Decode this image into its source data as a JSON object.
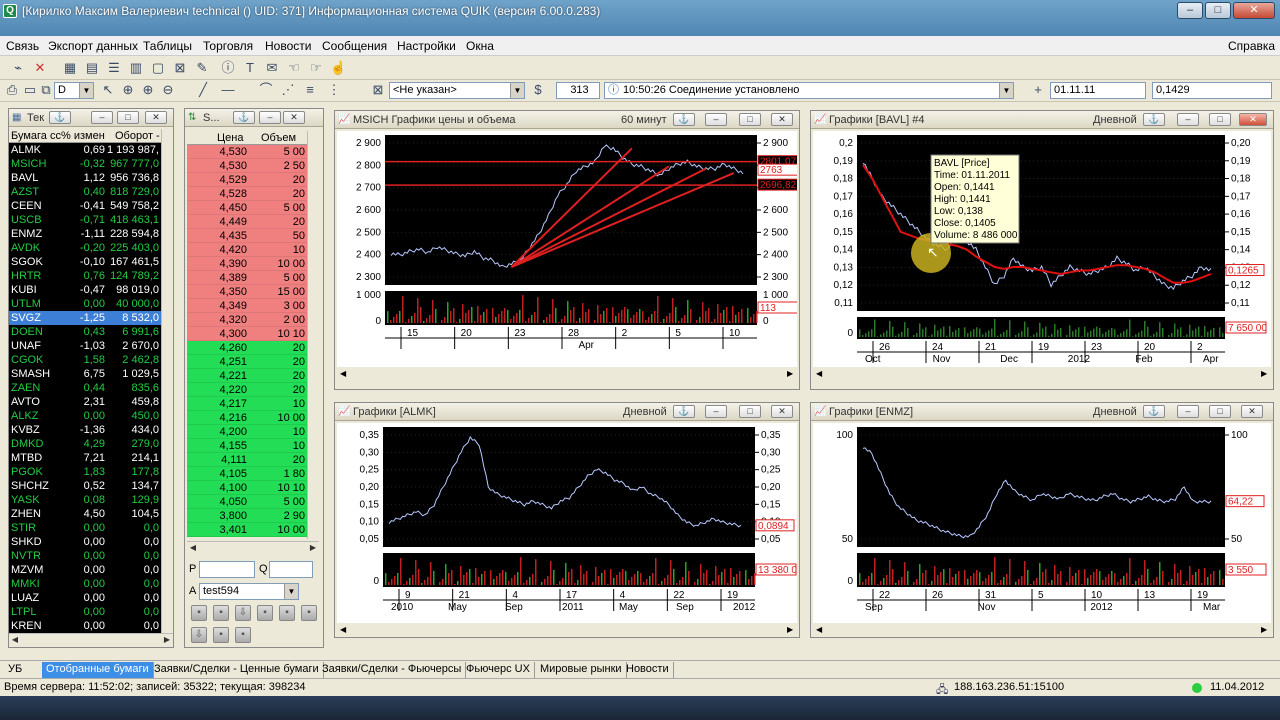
{
  "window": {
    "title": "[Кирилко Максим Валериевич technical ()  UID: 371] Информационная система QUIK (версия 6.00.0.283)",
    "icon": "Q",
    "controls": [
      "–",
      "□",
      "✕"
    ],
    "child_controls": [
      "–",
      "□",
      "✕"
    ]
  },
  "menu": {
    "items": [
      "Связь",
      "Экспорт данных",
      "Таблицы",
      "Торговля",
      "Новости",
      "Сообщения",
      "Настройки",
      "Окна"
    ],
    "help": "Справка"
  },
  "toolbar2": {
    "account_value": "D",
    "client_value": "<Не указан>",
    "count": "313",
    "message": "10:50:26 Соединение установлено",
    "date_value": "01.11.11",
    "price_value": "0,1429"
  },
  "securities": {
    "title": "Тек",
    "headers": [
      "Бумага сс",
      "% измен",
      "Оборот -"
    ],
    "rows": [
      {
        "code": "ALMK",
        "chg": "0,69",
        "turn": "1 193 987,0",
        "color": "#ffffff"
      },
      {
        "code": "MSICH",
        "chg": "-0,32",
        "turn": "967 777,0",
        "color": "#22cc44"
      },
      {
        "code": "BAVL",
        "chg": "1,12",
        "turn": "956 736,8",
        "color": "#ffffff"
      },
      {
        "code": "AZST",
        "chg": "0,40",
        "turn": "818 729,0",
        "color": "#22cc44"
      },
      {
        "code": "CEEN",
        "chg": "-0,41",
        "turn": "549 758,2",
        "color": "#ffffff"
      },
      {
        "code": "USCB",
        "chg": "-0,71",
        "turn": "418 463,1",
        "color": "#22cc44"
      },
      {
        "code": "ENMZ",
        "chg": "-1,11",
        "turn": "228 594,8",
        "color": "#ffffff"
      },
      {
        "code": "AVDK",
        "chg": "-0,20",
        "turn": "225 403,0",
        "color": "#22cc44"
      },
      {
        "code": "SGOK",
        "chg": "-0,10",
        "turn": "167 461,5",
        "color": "#ffffff"
      },
      {
        "code": "HRTR",
        "chg": "0,76",
        "turn": "124 789,2",
        "color": "#22cc44"
      },
      {
        "code": "KUBI",
        "chg": "-0,47",
        "turn": "98 019,0",
        "color": "#ffffff"
      },
      {
        "code": "UTLM",
        "chg": "0,00",
        "turn": "40 000,0",
        "color": "#22cc44"
      },
      {
        "code": "SVGZ",
        "chg": "-1,25",
        "turn": "8 532,0",
        "color": "#ffffff"
      },
      {
        "code": "DOEN",
        "chg": "0,43",
        "turn": "6 991,6",
        "color": "#22cc44"
      },
      {
        "code": "UNAF",
        "chg": "-1,03",
        "turn": "2 670,0",
        "color": "#ffffff"
      },
      {
        "code": "CGOK",
        "chg": "1,58",
        "turn": "2 462,8",
        "color": "#22cc44"
      },
      {
        "code": "SMASH",
        "chg": "6,75",
        "turn": "1 029,5",
        "color": "#ffffff"
      },
      {
        "code": "ZAEN",
        "chg": "0,44",
        "turn": "835,6",
        "color": "#22cc44"
      },
      {
        "code": "AVTO",
        "chg": "2,31",
        "turn": "459,8",
        "color": "#ffffff"
      },
      {
        "code": "ALKZ",
        "chg": "0,00",
        "turn": "450,0",
        "color": "#22cc44"
      },
      {
        "code": "KVBZ",
        "chg": "-1,36",
        "turn": "434,0",
        "color": "#ffffff"
      },
      {
        "code": "DMKD",
        "chg": "4,29",
        "turn": "279,0",
        "color": "#22cc44"
      },
      {
        "code": "MTBD",
        "chg": "7,21",
        "turn": "214,1",
        "color": "#ffffff"
      },
      {
        "code": "PGOK",
        "chg": "1,83",
        "turn": "177,8",
        "color": "#22cc44"
      },
      {
        "code": "SHCHZ",
        "chg": "0,52",
        "turn": "134,7",
        "color": "#ffffff"
      },
      {
        "code": "YASK",
        "chg": "0,08",
        "turn": "129,9",
        "color": "#22cc44"
      },
      {
        "code": "ZHEN",
        "chg": "4,50",
        "turn": "104,5",
        "color": "#ffffff"
      },
      {
        "code": "STIR",
        "chg": "0,00",
        "turn": "0,0",
        "color": "#22cc44"
      },
      {
        "code": "SHKD",
        "chg": "0,00",
        "turn": "0,0",
        "color": "#ffffff"
      },
      {
        "code": "NVTR",
        "chg": "0,00",
        "turn": "0,0",
        "color": "#22cc44"
      },
      {
        "code": "MZVM",
        "chg": "0,00",
        "turn": "0,0",
        "color": "#ffffff"
      },
      {
        "code": "MMKI",
        "chg": "0,00",
        "turn": "0,0",
        "color": "#22cc44"
      },
      {
        "code": "LUAZ",
        "chg": "0,00",
        "turn": "0,0",
        "color": "#ffffff"
      },
      {
        "code": "LTPL",
        "chg": "0,00",
        "turn": "0,0",
        "color": "#22cc44"
      },
      {
        "code": "KREN",
        "chg": "0,00",
        "turn": "0,0",
        "color": "#ffffff"
      }
    ]
  },
  "orderbook": {
    "title": "S...",
    "headers": [
      "Цена",
      "Объем"
    ],
    "asks": [
      {
        "p": "4,530",
        "v": "5 00"
      },
      {
        "p": "4,530",
        "v": "2 50"
      },
      {
        "p": "4,529",
        "v": "20"
      },
      {
        "p": "4,528",
        "v": "20"
      },
      {
        "p": "4,450",
        "v": "5 00"
      },
      {
        "p": "4,449",
        "v": "20"
      },
      {
        "p": "4,435",
        "v": "50"
      },
      {
        "p": "4,420",
        "v": "10"
      },
      {
        "p": "4,390",
        "v": "10 00"
      },
      {
        "p": "4,389",
        "v": "5 00"
      },
      {
        "p": "4,350",
        "v": "15 00"
      },
      {
        "p": "4,349",
        "v": "3 00"
      },
      {
        "p": "4,320",
        "v": "2 00"
      },
      {
        "p": "4,300",
        "v": "10 10"
      }
    ],
    "bids": [
      {
        "p": "4,260",
        "v": "20"
      },
      {
        "p": "4,251",
        "v": "20"
      },
      {
        "p": "4,221",
        "v": "20"
      },
      {
        "p": "4,220",
        "v": "20"
      },
      {
        "p": "4,217",
        "v": "10"
      },
      {
        "p": "4,216",
        "v": "10 00"
      },
      {
        "p": "4,200",
        "v": "10"
      },
      {
        "p": "4,155",
        "v": "10"
      },
      {
        "p": "4,111",
        "v": "20"
      },
      {
        "p": "4,105",
        "v": "1 80"
      },
      {
        "p": "4,100",
        "v": "10 10"
      },
      {
        "p": "4,050",
        "v": "5 00"
      },
      {
        "p": "3,800",
        "v": "2 90"
      },
      {
        "p": "3,401",
        "v": "10 00"
      }
    ],
    "p_label": "P",
    "q_label": "Q",
    "a_label": "A",
    "account": "test594"
  },
  "charts": [
    {
      "id": "msich",
      "title": "MSICH Графики цены и объема",
      "period": "60 минут",
      "y_ticks": [
        "2 900",
        "2 800",
        "2 700",
        "2 600",
        "2 500",
        "2 400",
        "2 300"
      ],
      "vol_ticks": [
        "1 000",
        "0"
      ],
      "x_ticks": [
        "15",
        "20",
        "23",
        "28",
        "2",
        "5",
        "10"
      ],
      "x_months": [
        "Apr"
      ],
      "price_tags": [
        "2801,07",
        "2763",
        "2696,82"
      ],
      "vol_tag": "113",
      "chart_data": {
        "type": "line",
        "ylim": [
          2250,
          2920
        ],
        "x": [
          0,
          10,
          20,
          30,
          40,
          50,
          60,
          70,
          80,
          90,
          100,
          110,
          120,
          130,
          140,
          150,
          160,
          170,
          180,
          190,
          200,
          210,
          220,
          230,
          240,
          250,
          260,
          270,
          280,
          290,
          300,
          310,
          320,
          330,
          340,
          350,
          360,
          370,
          380
        ],
        "values": [
          2390,
          2385,
          2400,
          2410,
          2395,
          2420,
          2405,
          2390,
          2380,
          2400,
          2370,
          2360,
          2330,
          2345,
          2360,
          2420,
          2480,
          2560,
          2650,
          2700,
          2760,
          2780,
          2800,
          2870,
          2860,
          2820,
          2790,
          2780,
          2760,
          2740,
          2770,
          2790,
          2800,
          2780,
          2770,
          2770,
          2790,
          2770,
          2750
        ],
        "hlines": [
          2801,
          2696
        ],
        "trend": [
          [
            130,
            2330,
            260,
            2860
          ],
          [
            130,
            2330,
            300,
            2780
          ],
          [
            130,
            2330,
            340,
            2770
          ],
          [
            130,
            2330,
            370,
            2750
          ]
        ]
      }
    },
    {
      "id": "bavl",
      "title": "Графики [BAVL] #4",
      "period": "Дневной",
      "y_ticks": [
        "0,20",
        "0,19",
        "0,18",
        "0,17",
        "0,16",
        "0,15",
        "0,14",
        "0,13",
        "0,12",
        "0,11"
      ],
      "y_ticks_left": [
        "0,2",
        "0,19",
        "0,18",
        "0,17",
        "0,16",
        "0,15",
        "0,14",
        "0,13",
        "0,12",
        "0,11"
      ],
      "vol_ticks": [
        "0"
      ],
      "x_ticks": [
        "26",
        "24",
        "21",
        "19",
        "23",
        "20",
        "2"
      ],
      "x_months": [
        "Oct",
        "Nov",
        "Dec",
        "2012",
        "Feb",
        "Apr"
      ],
      "price_tag": "0,1265",
      "vol_tag": "7 650 00",
      "tooltip": {
        "title": "BAVL [Price]",
        "lines": [
          "Time: 01.11.2011",
          "Open:  0,1441",
          "High:  0,1441",
          "Low:   0,138",
          "Close: 0,1405",
          "Volume: 8 486 000"
        ]
      },
      "chart_data": {
        "type": "line",
        "ylim": [
          0.105,
          0.205
        ],
        "values": [
          0.19,
          0.18,
          0.17,
          0.165,
          0.16,
          0.155,
          0.15,
          0.145,
          0.142,
          0.14,
          0.15,
          0.145,
          0.14,
          0.13,
          0.12,
          0.125,
          0.135,
          0.13,
          0.128,
          0.13,
          0.12,
          0.125,
          0.13,
          0.128,
          0.126,
          0.128,
          0.13,
          0.135,
          0.132,
          0.128,
          0.13,
          0.125,
          0.12,
          0.118,
          0.122,
          0.125,
          0.13,
          0.128
        ],
        "ma": [
          0.188,
          0.18,
          0.17,
          0.16,
          0.15,
          0.148,
          0.146,
          0.145,
          0.144,
          0.143,
          0.142,
          0.14,
          0.136,
          0.133,
          0.13,
          0.129,
          0.13,
          0.13,
          0.129,
          0.128,
          0.127,
          0.126,
          0.127,
          0.128,
          0.128,
          0.129,
          0.13,
          0.131,
          0.131,
          0.13,
          0.129,
          0.127,
          0.124,
          0.121,
          0.121,
          0.122,
          0.124,
          0.126
        ]
      }
    },
    {
      "id": "almk",
      "title": "Графики [ALMK]",
      "period": "Дневной",
      "y_ticks": [
        "0,35",
        "0,30",
        "0,25",
        "0,20",
        "0,15",
        "0,10",
        "0,05"
      ],
      "vol_ticks": [
        "0"
      ],
      "x_ticks": [
        "9",
        "21",
        "4",
        "17",
        "4",
        "22",
        "19"
      ],
      "x_months": [
        "2010",
        "May",
        "Sep",
        "2011",
        "May",
        "Sep",
        "2012"
      ],
      "price_tag": "0,0894",
      "vol_tag": "13 380 0",
      "chart_data": {
        "type": "line",
        "ylim": [
          0.03,
          0.37
        ],
        "values": [
          0.1,
          0.11,
          0.12,
          0.13,
          0.12,
          0.15,
          0.2,
          0.25,
          0.3,
          0.34,
          0.32,
          0.2,
          0.18,
          0.17,
          0.16,
          0.15,
          0.16,
          0.15,
          0.14,
          0.16,
          0.17,
          0.2,
          0.23,
          0.25,
          0.24,
          0.22,
          0.21,
          0.19,
          0.2,
          0.18,
          0.17,
          0.15,
          0.12,
          0.1,
          0.09,
          0.1,
          0.11,
          0.1,
          0.095,
          0.09
        ]
      }
    },
    {
      "id": "enmz",
      "title": "Графики [ENMZ]",
      "period": "Дневной",
      "y_ticks": [
        "100",
        "50"
      ],
      "vol_ticks": [
        "0"
      ],
      "x_ticks": [
        "22",
        "26",
        "31",
        "5",
        "10",
        "13",
        "19"
      ],
      "x_months": [
        "Sep",
        "Nov",
        "2012",
        "Mar"
      ],
      "price_tag": "64,22",
      "vol_tag": "3 550",
      "chart_data": {
        "type": "line",
        "ylim": [
          30,
          120
        ],
        "values": [
          105,
          100,
          85,
          70,
          60,
          55,
          50,
          48,
          45,
          42,
          40,
          38,
          38,
          45,
          55,
          70,
          80,
          72,
          68,
          65,
          70,
          68,
          66,
          70,
          68,
          66,
          65,
          68,
          70,
          66,
          64,
          66,
          68,
          65,
          64,
          66,
          75,
          64,
          64,
          64
        ]
      }
    }
  ],
  "tabs": [
    "УБ",
    "Отобранные бумаги",
    "Заявки/Сделки - Ценные бумаги",
    "Заявки/Сделки - Фьючерсы",
    "Фьючерс UX",
    "Мировые рынки",
    "Новости"
  ],
  "status": {
    "server_time": "Время сервера: 11:52:02; записей: 35322; текущая: 398234",
    "ip": "188.163.236.51:15100",
    "date": "11.04.2012"
  }
}
